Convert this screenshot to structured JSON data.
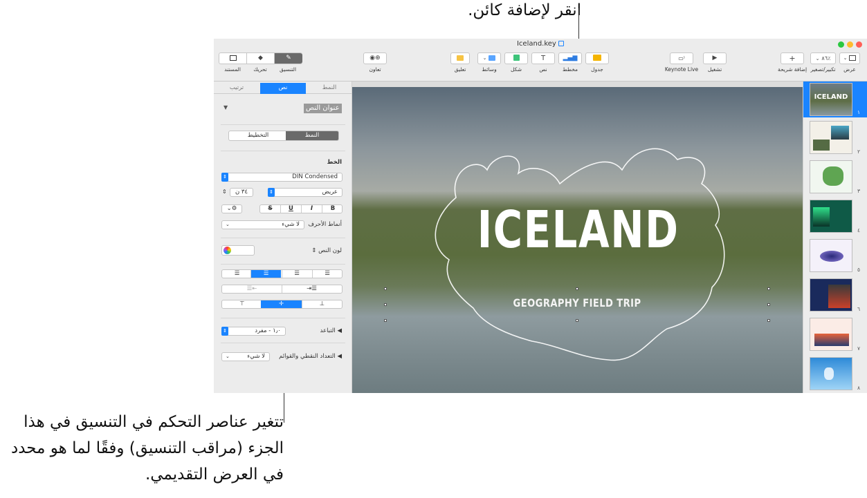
{
  "callouts": {
    "top": "انقر لإضافة كائن.",
    "bottom": "تتغير عناصر التحكم في التنسيق في هذا الجزء (مراقب التنسيق) وفقًا لما هو محدد في العرض التقديمي."
  },
  "window": {
    "title": "Iceland.key"
  },
  "toolbar": {
    "view": "عرض",
    "zoom_value": "٨٦٪",
    "zoom": "تكبير/تصغير",
    "add_slide": "إضافة شريحة",
    "play": "تشغيل",
    "keynote_live": "Keynote Live",
    "table": "جدول",
    "chart": "مخطط",
    "text": "نص",
    "shape": "شكل",
    "media": "وسائط",
    "comment": "تعليق",
    "collaborate": "تعاون",
    "format": "التنسيق",
    "animate": "تحريك",
    "document": "المستند"
  },
  "inspector": {
    "tabs": [
      "النمط",
      "نص",
      "ترتيب"
    ],
    "paragraph_style": "عنوان النص",
    "subtabs": [
      "النمط",
      "التخطيط"
    ],
    "font_section": "الخط",
    "font_name": "DIN Condensed",
    "font_weight": "عريض",
    "font_size": "٣٤ ن",
    "bold": "B",
    "italic": "I",
    "underline": "U",
    "strike": "S",
    "char_styles_label": "أنماط الأحرف",
    "char_styles_value": "لا شيء",
    "text_color_label": "لون النص",
    "spacing_label": "التباعد",
    "spacing_value": "١٫٠ - مفرد",
    "bullets_label": "التعداد النقطي والقوائم",
    "bullets_value": "لا شيء"
  },
  "slide": {
    "title": "ICELAND",
    "subtitle": "GEOGRAPHY FIELD TRIP"
  },
  "navigator": {
    "numbers": [
      "١",
      "٢",
      "٣",
      "٤",
      "٥",
      "٦",
      "٧",
      "٨"
    ],
    "thumb1_title": "ICELAND"
  },
  "colors": {
    "accent": "#1a84ff",
    "slide_text": "#ffffff"
  }
}
